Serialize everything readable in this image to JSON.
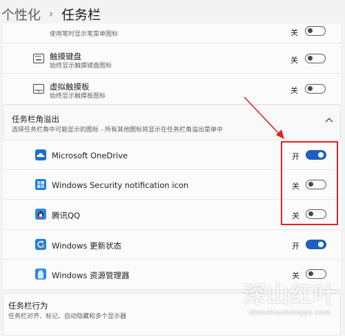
{
  "breadcrumb": {
    "parent": "个性化",
    "separator": "›",
    "current": "任务栏"
  },
  "pen_menu": {
    "subtitle": "使用笔时显示笔菜单图标",
    "state_label": "关",
    "on": false
  },
  "touch_keyboard": {
    "title": "触摸键盘",
    "subtitle": "始终显示触摸键盘图标",
    "state_label": "关",
    "on": false,
    "icon": "keyboard-icon"
  },
  "virtual_touchpad": {
    "title": "虚拟触摸板",
    "subtitle": "始终显示触摸板图标",
    "state_label": "关",
    "on": false,
    "icon": "touchpad-icon"
  },
  "overflow_section": {
    "title": "任务栏角溢出",
    "subtitle": "选择任务栏角中可能显示的图标 - 所有其他图标将显示在任务栏角溢出菜单中",
    "expanded": true,
    "items": [
      {
        "name": "Microsoft OneDrive",
        "state_label": "开",
        "on": true,
        "icon": "onedrive-icon",
        "icon_color": "#1e6fcf"
      },
      {
        "name": "Windows Security notification icon",
        "state_label": "关",
        "on": false,
        "icon": "security-shield-icon",
        "icon_color": "#1f7fd6"
      },
      {
        "name": "腾讯QQ",
        "state_label": "关",
        "on": false,
        "icon": "qq-penguin-icon",
        "icon_color": "#2d86e0"
      },
      {
        "name": "Windows 更新状态",
        "state_label": "开",
        "on": true,
        "icon": "windows-update-icon",
        "icon_color": "#1f7ee0"
      },
      {
        "name": "Windows 资源管理器",
        "state_label": "关",
        "on": false,
        "icon": "usb-drive-icon",
        "icon_color": "#2a8ae0"
      }
    ]
  },
  "taskbar_behavior": {
    "title": "任务栏行为",
    "subtitle": "任务栏对齐、标记、自动隐藏和多个显示器"
  },
  "watermark": {
    "main": "深山红叶",
    "url": "shenshanhongye.com"
  },
  "colors": {
    "accent": "#1f5fbf",
    "highlight": "#e02121"
  }
}
